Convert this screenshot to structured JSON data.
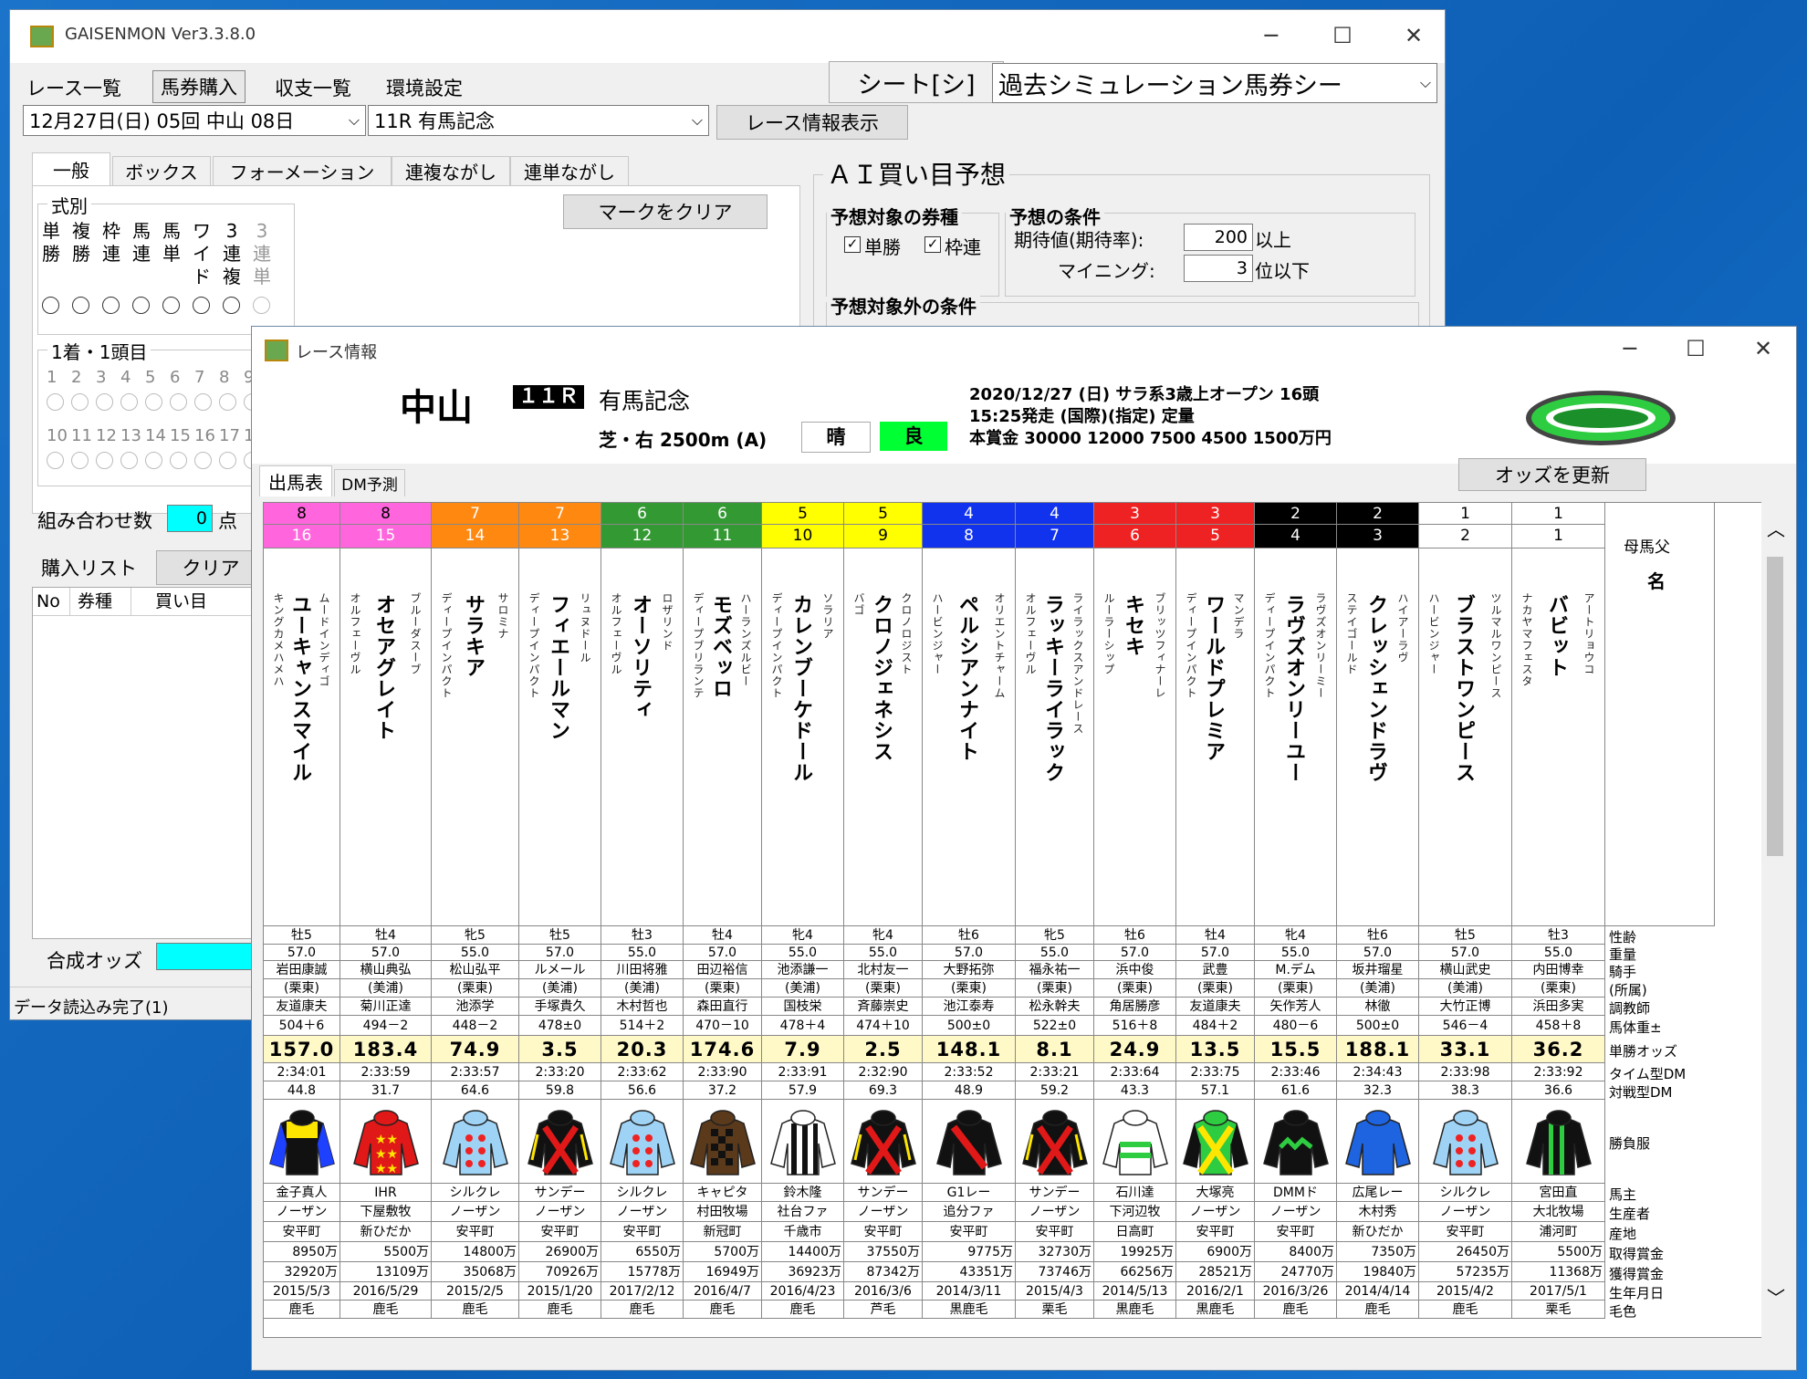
{
  "main_window": {
    "title": "GAISENMON Ver3.3.8.0",
    "menu": [
      "レース一覧",
      "馬券購入",
      "収支一覧",
      "環境設定"
    ],
    "sheet_label": "シート[シ]",
    "sheet_select": "過去シミュレーション馬券シー",
    "date_select": "12月27日(日) 05回 中山 08日",
    "race_select": "11R 有馬記念",
    "race_info_button": "レース情報表示",
    "tabs": [
      "一般",
      "ボックス",
      "フォーメーション",
      "連複ながし",
      "連単ながし"
    ],
    "clear_marks_button": "マークをクリア",
    "shiki_group": "式別",
    "shiki_labels": [
      "単勝",
      "複勝",
      "枠連",
      "馬連",
      "馬単",
      "ワイド",
      "3連複",
      "3連単"
    ],
    "first_group": "1着・1頭目",
    "numbers_row1": [
      "1",
      "2",
      "3",
      "4",
      "5",
      "6",
      "7",
      "8",
      "9"
    ],
    "numbers_row2": [
      "10",
      "11",
      "12",
      "13",
      "14",
      "15",
      "16",
      "17",
      "1"
    ],
    "combo_label": "組み合わせ数",
    "combo_value": "0",
    "combo_unit": "点",
    "purchase_list": "購入リスト",
    "clear_button": "クリア",
    "list_headers": [
      "No",
      "券種",
      "買い目"
    ],
    "composite_odds_label": "合成オッズ",
    "status": "データ読込み完了(1)",
    "ai_title": "ＡＩ買い目予想",
    "ai_target_title": "予想対象の券種",
    "ai_target_checks": [
      "単勝",
      "枠連"
    ],
    "ai_cond_title": "予想の条件",
    "ai_expect_label": "期待値(期待率):",
    "ai_expect_value": "200",
    "ai_expect_unit": "以上",
    "ai_mining_label": "マイニング:",
    "ai_mining_value": "3",
    "ai_mining_unit": "位以下",
    "ai_exclude_title": "予想対象外の条件"
  },
  "race_window": {
    "title": "レース情報",
    "venue": "中山",
    "race_no": "１１Ｒ",
    "race_name": "有馬記念",
    "course": "芝・右 2500m (A)",
    "weather": "晴",
    "going": "良",
    "info1": "2020/12/27 (日) サラ系3歳上オープン 16頭",
    "info2": "15:25発走 (国際)(指定) 定量",
    "info3": "本賞金 30000 12000 7500 4500 1500万円",
    "tabs": [
      "出馬表",
      "DM予測"
    ],
    "update_odds_button": "オッズを更新",
    "header_right_top": "母馬父",
    "header_right_name": "名",
    "row_labels": [
      "性齢",
      "重量",
      "騎手",
      "(所属)",
      "調教師",
      "馬体重±",
      "単勝オッズ",
      "タイム型DM",
      "対戦型DM",
      "勝負服",
      "馬主",
      "生産者",
      "産地",
      "取得賞金",
      "獲得賞金",
      "生年月日",
      "毛色"
    ],
    "colors": {
      "waku1": "#ffffff",
      "waku2": "#000000",
      "waku3": "#ee2222",
      "waku4": "#1133ee",
      "waku5": "#ffff00",
      "waku6": "#339933",
      "waku7": "#ff8811",
      "waku8": "#ff66dd"
    },
    "horses": [
      {
        "waku": "8",
        "num": "16",
        "wcolor": "#ff66dd",
        "wtext": "#000",
        "ncolor": "#ff66dd",
        "ntext": "#fff",
        "name": "ユーキャンスマイル",
        "sire": "キングカメハメハ",
        "dam_sire": "ムードインディゴ",
        "sexage": "牡5",
        "weight": "57.0",
        "jockey": "岩田康誠",
        "shozoku": "(栗東)",
        "trainer": "友道康夫",
        "bw": "504＋6",
        "odds": "157.0",
        "tdm": "2:34:01",
        "vdm": "44.8",
        "silk": "yellowblack",
        "owner": "金子真人",
        "breeder": "ノーザン",
        "area": "安平町",
        "prize1": "8950万",
        "prize2": "32920万",
        "birth": "2015/5/3",
        "coat": "鹿毛"
      },
      {
        "waku": "8",
        "num": "15",
        "wcolor": "#ff66dd",
        "wtext": "#000",
        "ncolor": "#ff66dd",
        "ntext": "#fff",
        "name": "オセアグレイト",
        "sire": "オルフェーヴル",
        "dam_sire": "ブルーダスーブ",
        "sexage": "牡4",
        "weight": "57.0",
        "jockey": "横山典弘",
        "shozoku": "(美浦)",
        "trainer": "菊川正達",
        "bw": "494－2",
        "odds": "183.4",
        "tdm": "2:33:59",
        "vdm": "31.7",
        "silk": "redstars",
        "owner": "IHR",
        "breeder": "下屋敷牧",
        "area": "新ひだか",
        "prize1": "5500万",
        "prize2": "13109万",
        "birth": "2016/5/29",
        "coat": "鹿毛"
      },
      {
        "waku": "7",
        "num": "14",
        "wcolor": "#ff8811",
        "wtext": "#fff",
        "ncolor": "#ff8811",
        "ntext": "#fff",
        "name": "サラキア",
        "sire": "ディープインパクト",
        "dam_sire": "サロミナ",
        "sexage": "牝5",
        "weight": "55.0",
        "jockey": "松山弘平",
        "shozoku": "(栗東)",
        "trainer": "池添学",
        "bw": "448－2",
        "odds": "74.9",
        "tdm": "2:33:57",
        "vdm": "64.6",
        "silk": "bluedots",
        "owner": "シルクレ",
        "breeder": "ノーザン",
        "area": "安平町",
        "prize1": "14800万",
        "prize2": "35068万",
        "birth": "2015/2/5",
        "coat": "鹿毛"
      },
      {
        "waku": "7",
        "num": "13",
        "wcolor": "#ff8811",
        "wtext": "#fff",
        "ncolor": "#ff8811",
        "ntext": "#fff",
        "name": "フィエールマン",
        "sire": "ディープインパクト",
        "dam_sire": "リュヌドール",
        "sexage": "牡5",
        "weight": "57.0",
        "jockey": "ルメール",
        "shozoku": "(美浦)",
        "trainer": "手塚貴久",
        "bw": "478±0",
        "odds": "3.5",
        "tdm": "2:33:20",
        "vdm": "59.8",
        "silk": "blackredx",
        "owner": "サンデー",
        "breeder": "ノーザン",
        "area": "安平町",
        "prize1": "26900万",
        "prize2": "70926万",
        "birth": "2015/1/20",
        "coat": "鹿毛"
      },
      {
        "waku": "6",
        "num": "12",
        "wcolor": "#339933",
        "wtext": "#fff",
        "ncolor": "#339933",
        "ntext": "#fff",
        "name": "オーソリティ",
        "sire": "オルフェーヴル",
        "dam_sire": "ロザリンド",
        "sexage": "牡3",
        "weight": "55.0",
        "jockey": "川田将雅",
        "shozoku": "(美浦)",
        "trainer": "木村哲也",
        "bw": "514＋2",
        "odds": "20.3",
        "tdm": "2:33:62",
        "vdm": "56.6",
        "silk": "bluedots",
        "owner": "シルクレ",
        "breeder": "ノーザン",
        "area": "安平町",
        "prize1": "6550万",
        "prize2": "15778万",
        "birth": "2017/2/12",
        "coat": "鹿毛"
      },
      {
        "waku": "6",
        "num": "11",
        "wcolor": "#339933",
        "wtext": "#fff",
        "ncolor": "#339933",
        "ntext": "#fff",
        "name": "モズベッロ",
        "sire": "ディープブリランテ",
        "dam_sire": "ハーランズルビー",
        "sexage": "牡4",
        "weight": "57.0",
        "jockey": "田辺裕信",
        "shozoku": "(栗東)",
        "trainer": "森田直行",
        "bw": "470－10",
        "odds": "174.6",
        "tdm": "2:33:90",
        "vdm": "37.2",
        "silk": "brownchecks",
        "owner": "キャピタ",
        "breeder": "村田牧場",
        "area": "新冠町",
        "prize1": "5700万",
        "prize2": "16949万",
        "birth": "2016/4/7",
        "coat": "鹿毛"
      },
      {
        "waku": "5",
        "num": "10",
        "wcolor": "#ffff00",
        "wtext": "#000",
        "ncolor": "#ffff00",
        "ntext": "#000",
        "name": "カレンブーケドール",
        "sire": "ディープインパクト",
        "dam_sire": "ソラリア",
        "sexage": "牝4",
        "weight": "55.0",
        "jockey": "池添謙一",
        "shozoku": "(美浦)",
        "trainer": "国枝栄",
        "bw": "478＋4",
        "odds": "7.9",
        "tdm": "2:33:91",
        "vdm": "57.9",
        "silk": "blackstripes",
        "owner": "鈴木隆",
        "breeder": "社台ファ",
        "area": "千歳市",
        "prize1": "14400万",
        "prize2": "36923万",
        "birth": "2016/4/23",
        "coat": "鹿毛"
      },
      {
        "waku": "5",
        "num": "9",
        "wcolor": "#ffff00",
        "wtext": "#000",
        "ncolor": "#ffff00",
        "ntext": "#000",
        "name": "クロノジェネシス",
        "sire": "バゴ",
        "dam_sire": "クロノロジスト",
        "sexage": "牝4",
        "weight": "55.0",
        "jockey": "北村友一",
        "shozoku": "(栗東)",
        "trainer": "斉藤崇史",
        "bw": "474＋10",
        "odds": "2.5",
        "tdm": "2:32:90",
        "vdm": "69.3",
        "silk": "blackredx",
        "owner": "サンデー",
        "breeder": "ノーザン",
        "area": "安平町",
        "prize1": "37550万",
        "prize2": "87342万",
        "birth": "2016/3/6",
        "coat": "芦毛"
      },
      {
        "waku": "4",
        "num": "8",
        "wcolor": "#1133ee",
        "wtext": "#fff",
        "ncolor": "#1133ee",
        "ntext": "#fff",
        "name": "ペルシアンナイト",
        "sire": "ハービンジャー",
        "dam_sire": "オリエントチャーム",
        "sexage": "牡6",
        "weight": "57.0",
        "jockey": "大野拓弥",
        "shozoku": "(栗東)",
        "trainer": "池江泰寿",
        "bw": "500±0",
        "odds": "148.1",
        "tdm": "2:33:52",
        "vdm": "48.9",
        "silk": "blackredsash",
        "owner": "G1レー",
        "breeder": "追分ファ",
        "area": "安平町",
        "prize1": "9775万",
        "prize2": "43351万",
        "birth": "2014/3/11",
        "coat": "黒鹿毛"
      },
      {
        "waku": "4",
        "num": "7",
        "wcolor": "#1133ee",
        "wtext": "#fff",
        "ncolor": "#1133ee",
        "ntext": "#fff",
        "name": "ラッキーライラック",
        "sire": "オルフェーヴル",
        "dam_sire": "ライラックスアンドレース",
        "sexage": "牝5",
        "weight": "55.0",
        "jockey": "福永祐一",
        "shozoku": "(栗東)",
        "trainer": "松永幹夫",
        "bw": "522±0",
        "odds": "8.1",
        "tdm": "2:33:21",
        "vdm": "59.2",
        "silk": "blackredx",
        "owner": "サンデー",
        "breeder": "ノーザン",
        "area": "安平町",
        "prize1": "32730万",
        "prize2": "73746万",
        "birth": "2015/4/3",
        "coat": "栗毛"
      },
      {
        "waku": "3",
        "num": "6",
        "wcolor": "#ee2222",
        "wtext": "#fff",
        "ncolor": "#ee2222",
        "ntext": "#fff",
        "name": "キセキ",
        "sire": "ルーラーシップ",
        "dam_sire": "ブリッツフィナーレ",
        "sexage": "牡6",
        "weight": "57.0",
        "jockey": "浜中俊",
        "shozoku": "(栗東)",
        "trainer": "角居勝彦",
        "bw": "516＋8",
        "odds": "24.9",
        "tdm": "2:33:64",
        "vdm": "43.3",
        "silk": "whitegreen",
        "owner": "石川達",
        "breeder": "下河辺牧",
        "area": "日高町",
        "prize1": "19925万",
        "prize2": "66256万",
        "birth": "2014/5/13",
        "coat": "黒鹿毛"
      },
      {
        "waku": "3",
        "num": "5",
        "wcolor": "#ee2222",
        "wtext": "#fff",
        "ncolor": "#ee2222",
        "ntext": "#fff",
        "name": "ワールドプレミア",
        "sire": "ディープインパクト",
        "dam_sire": "マンデラ",
        "sexage": "牡4",
        "weight": "57.0",
        "jockey": "武豊",
        "shozoku": "(栗東)",
        "trainer": "友道康夫",
        "bw": "484＋2",
        "odds": "13.5",
        "tdm": "2:33:75",
        "vdm": "57.1",
        "silk": "greenyellowx",
        "owner": "大塚亮",
        "breeder": "ノーザン",
        "area": "安平町",
        "prize1": "6900万",
        "prize2": "28521万",
        "birth": "2016/2/1",
        "coat": "黒鹿毛"
      },
      {
        "waku": "2",
        "num": "4",
        "wcolor": "#000000",
        "wtext": "#fff",
        "ncolor": "#000000",
        "ntext": "#fff",
        "name": "ラヴズオンリーユー",
        "sire": "ディープインパクト",
        "dam_sire": "ラヴズオンリーミー",
        "sexage": "牝4",
        "weight": "55.0",
        "jockey": "M.デム",
        "shozoku": "(栗東)",
        "trainer": "矢作芳人",
        "bw": "480－6",
        "odds": "15.5",
        "tdm": "2:33:46",
        "vdm": "61.6",
        "silk": "blackgreenzig",
        "owner": "DMMド",
        "breeder": "ノーザン",
        "area": "安平町",
        "prize1": "8400万",
        "prize2": "24770万",
        "birth": "2016/3/26",
        "coat": "鹿毛"
      },
      {
        "waku": "2",
        "num": "3",
        "wcolor": "#000000",
        "wtext": "#fff",
        "ncolor": "#000000",
        "ntext": "#fff",
        "name": "クレッシェンドラヴ",
        "sire": "ステイゴールド",
        "dam_sire": "ハイアーラヴ",
        "sexage": "牡6",
        "weight": "57.0",
        "jockey": "坂井瑠星",
        "shozoku": "(美浦)",
        "trainer": "林徹",
        "bw": "500±0",
        "odds": "188.1",
        "tdm": "2:34:43",
        "vdm": "32.3",
        "silk": "blueplain",
        "owner": "広尾レー",
        "breeder": "木村秀",
        "area": "新ひだか",
        "prize1": "7350万",
        "prize2": "19840万",
        "birth": "2014/4/14",
        "coat": "鹿毛"
      },
      {
        "waku": "1",
        "num": "2",
        "wcolor": "#ffffff",
        "wtext": "#000",
        "ncolor": "#ffffff",
        "ntext": "#000",
        "name": "ブラストワンピース",
        "sire": "ハービンジャー",
        "dam_sire": "ツルマルワンピース",
        "sexage": "牡5",
        "weight": "57.0",
        "jockey": "横山武史",
        "shozoku": "(美浦)",
        "trainer": "大竹正博",
        "bw": "546－4",
        "odds": "33.1",
        "tdm": "2:33:98",
        "vdm": "38.3",
        "silk": "bluedots",
        "owner": "シルクレ",
        "breeder": "ノーザン",
        "area": "安平町",
        "prize1": "26450万",
        "prize2": "57235万",
        "birth": "2015/4/2",
        "coat": "鹿毛"
      },
      {
        "waku": "1",
        "num": "1",
        "wcolor": "#ffffff",
        "wtext": "#000",
        "ncolor": "#ffffff",
        "ntext": "#000",
        "name": "バビット",
        "sire": "ナカヤマフェスタ",
        "dam_sire": "アートリョウコ",
        "sexage": "牡3",
        "weight": "55.0",
        "jockey": "内田博幸",
        "shozoku": "(栗東)",
        "trainer": "浜田多実",
        "bw": "458＋8",
        "odds": "36.2",
        "tdm": "2:33:92",
        "vdm": "36.6",
        "silk": "blackgreenstripes",
        "owner": "宮田直",
        "breeder": "大北牧場",
        "area": "浦河町",
        "prize1": "5500万",
        "prize2": "11368万",
        "birth": "2017/5/1",
        "coat": "栗毛"
      }
    ]
  }
}
